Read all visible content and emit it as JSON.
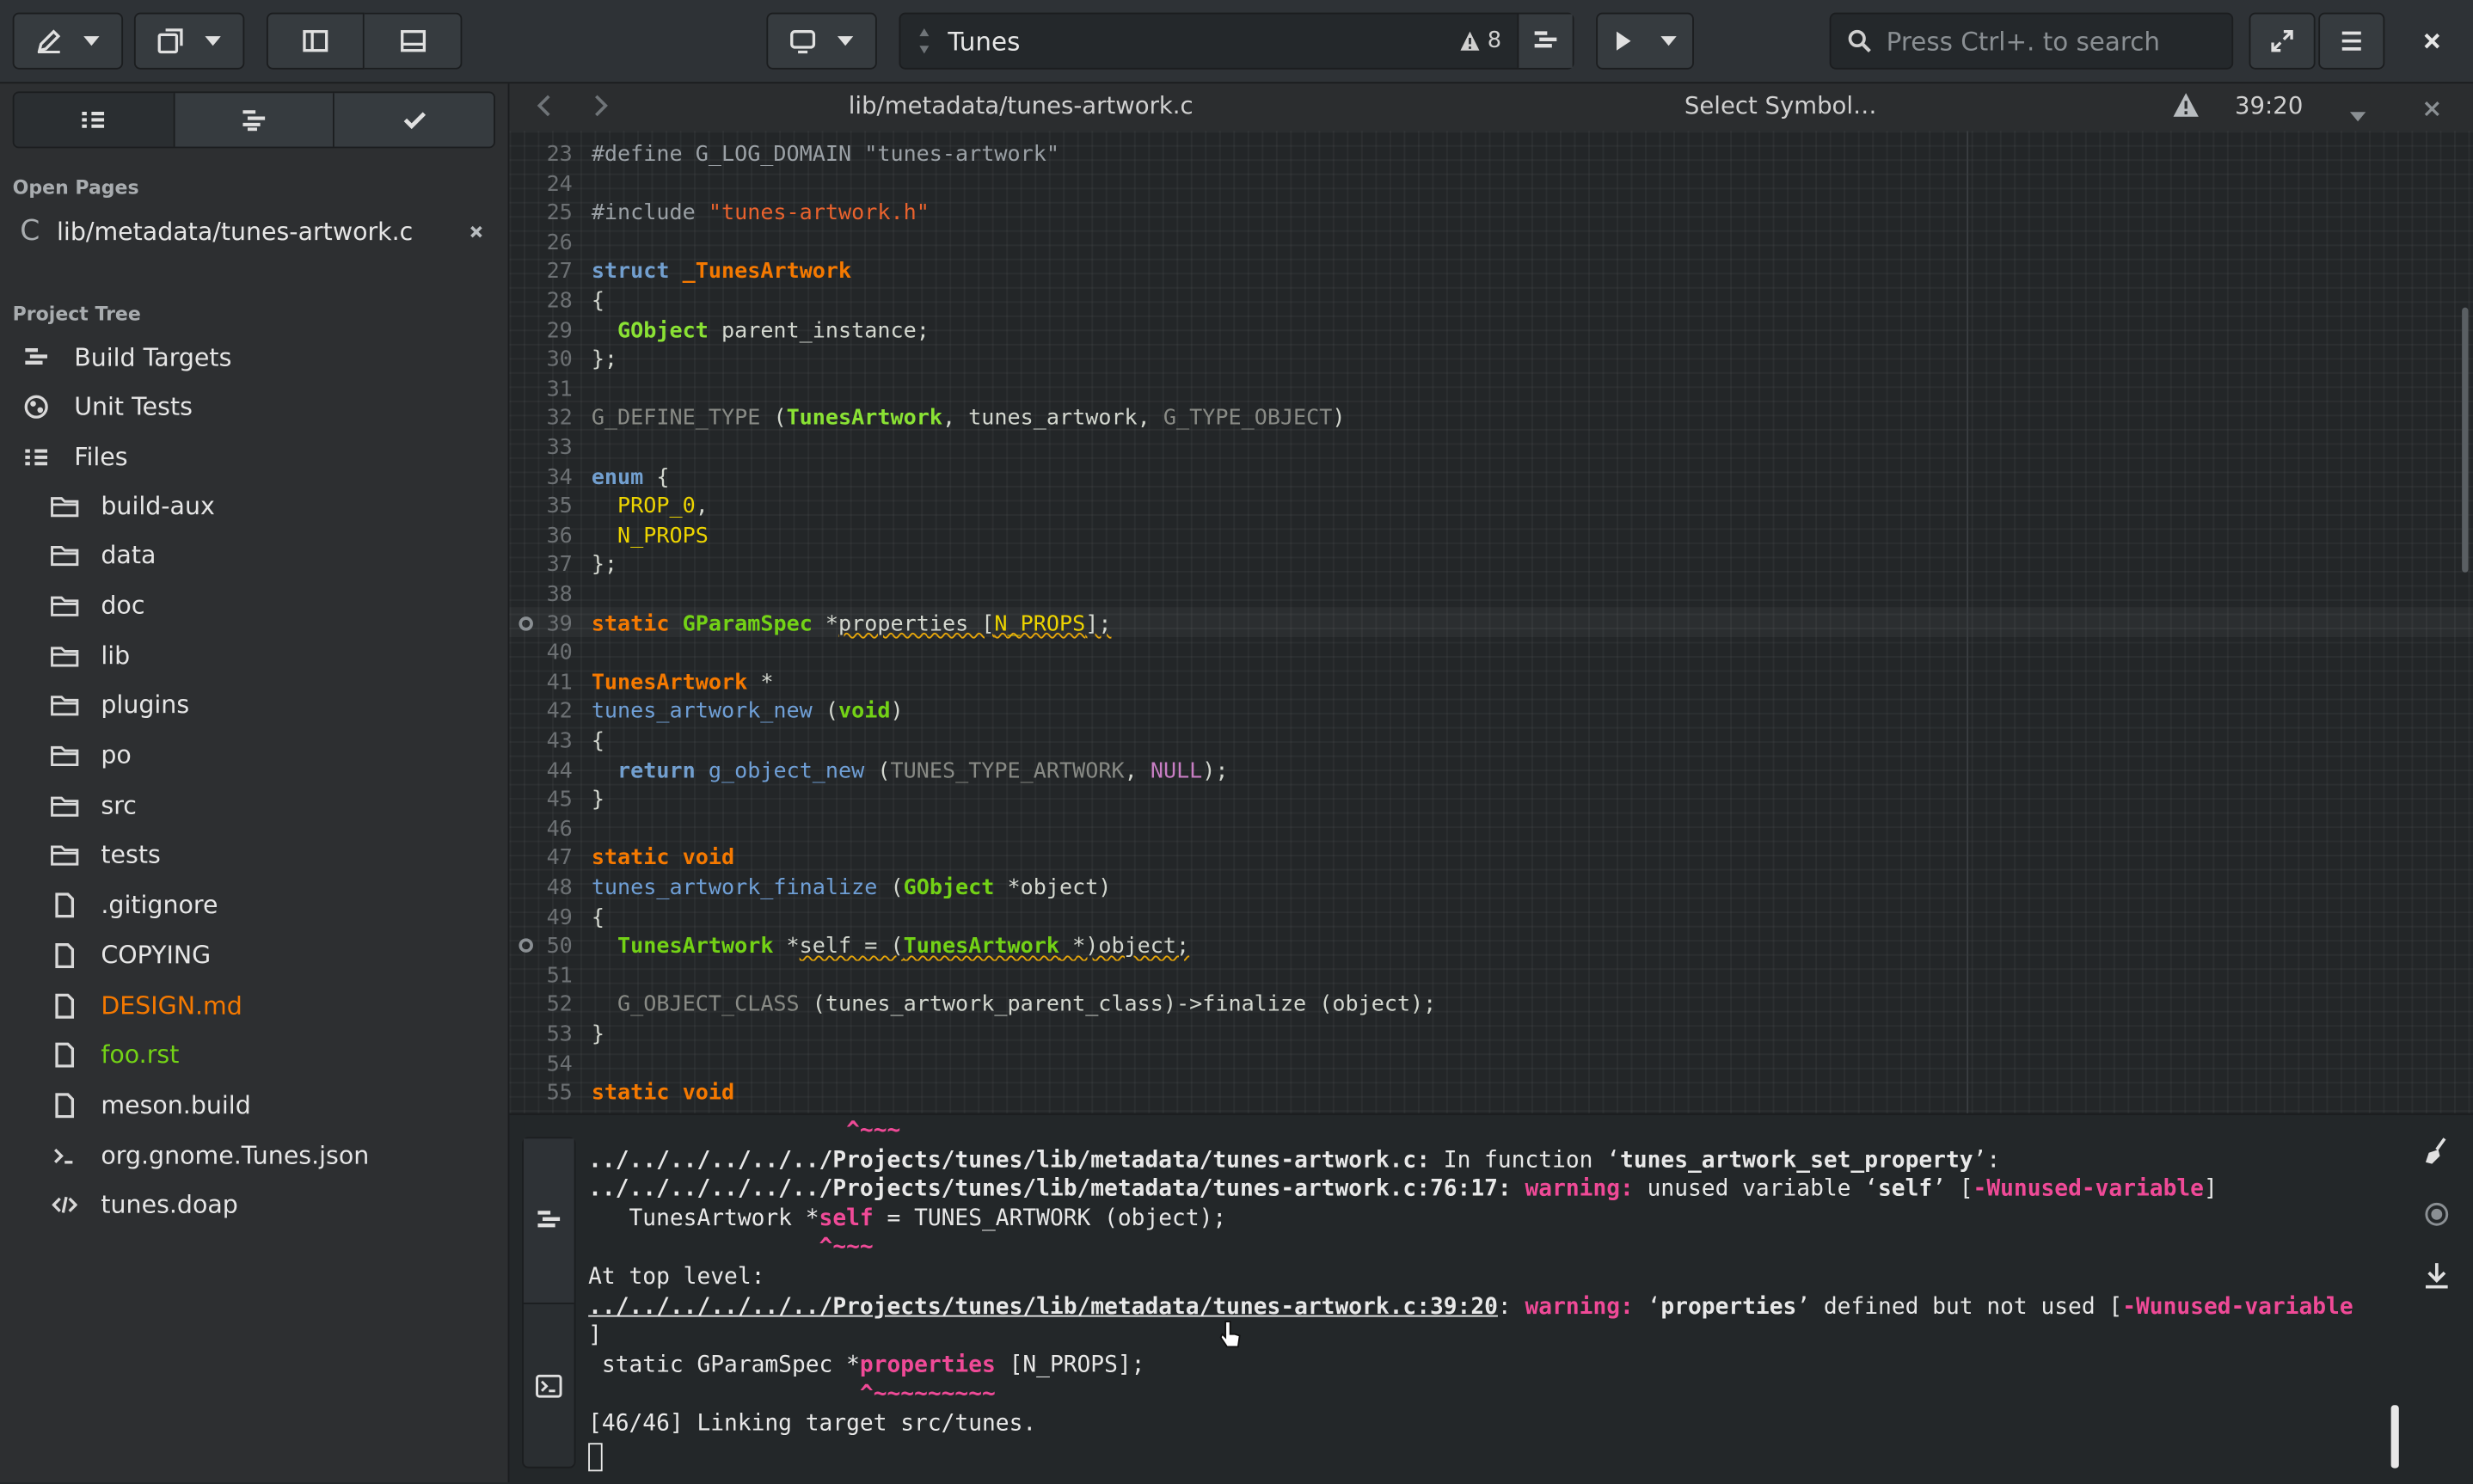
{
  "header": {
    "project_name": "Tunes",
    "warning_count": "8",
    "search_placeholder": "Press Ctrl+. to search"
  },
  "sidebar": {
    "open_pages_title": "Open Pages",
    "open_page": "lib/metadata/tunes-artwork.c",
    "open_page_icon_text": "C",
    "project_tree_title": "Project Tree",
    "top_items": [
      {
        "label": "Build Targets",
        "icon": "build-targets-icon"
      },
      {
        "label": "Unit Tests",
        "icon": "unit-tests-icon"
      },
      {
        "label": "Files",
        "icon": "files-icon"
      }
    ],
    "files": [
      {
        "label": "build-aux",
        "kind": "folder",
        "color": "#e6e6e6"
      },
      {
        "label": "data",
        "kind": "folder",
        "color": "#e6e6e6"
      },
      {
        "label": "doc",
        "kind": "folder",
        "color": "#e6e6e6"
      },
      {
        "label": "lib",
        "kind": "folder",
        "color": "#e6e6e6"
      },
      {
        "label": "plugins",
        "kind": "folder",
        "color": "#e6e6e6"
      },
      {
        "label": "po",
        "kind": "folder",
        "color": "#e6e6e6"
      },
      {
        "label": "src",
        "kind": "folder",
        "color": "#e6e6e6"
      },
      {
        "label": "tests",
        "kind": "folder",
        "color": "#e6e6e6"
      },
      {
        "label": ".gitignore",
        "kind": "file",
        "color": "#e6e6e6"
      },
      {
        "label": "COPYING",
        "kind": "file",
        "color": "#e6e6e6"
      },
      {
        "label": "DESIGN.md",
        "kind": "file",
        "color": "#f57900"
      },
      {
        "label": "foo.rst",
        "kind": "file",
        "color": "#73d216"
      },
      {
        "label": "meson.build",
        "kind": "file",
        "color": "#e6e6e6"
      },
      {
        "label": "org.gnome.Tunes.json",
        "kind": "terminal",
        "color": "#e6e6e6"
      },
      {
        "label": "tunes.doap",
        "kind": "code",
        "color": "#e6e6e6"
      }
    ]
  },
  "editor": {
    "file_path": "lib/metadata/tunes-artwork.c",
    "symbol_selector": "Select Symbol…",
    "cursor_position": "39:20",
    "lines": [
      {
        "n": "23",
        "html": "<span class=\"pp\">#define G_LOG_DOMAIN \"tunes-artwork\"</span>"
      },
      {
        "n": "24",
        "html": ""
      },
      {
        "n": "25",
        "html": "<span class=\"pp\">#include </span><span class=\"st\">\"tunes-artwork.h\"</span>"
      },
      {
        "n": "26",
        "html": ""
      },
      {
        "n": "27",
        "html": "<span class=\"kw\">struct</span> <span class=\"kw2\">_TunesArtwork</span>"
      },
      {
        "n": "28",
        "html": "{"
      },
      {
        "n": "29",
        "html": "  <span class=\"ty2\">GObject</span> parent_instance;"
      },
      {
        "n": "30",
        "html": "};"
      },
      {
        "n": "31",
        "html": ""
      },
      {
        "n": "32",
        "html": "<span class=\"mac\">G_DEFINE_TYPE</span> (<span class=\"ty2\">TunesArtwork</span>, tunes_artwork, <span class=\"mac\">G_TYPE_OBJECT</span>)"
      },
      {
        "n": "33",
        "html": ""
      },
      {
        "n": "34",
        "html": "<span class=\"kw\">enum</span> {"
      },
      {
        "n": "35",
        "html": "  <span class=\"cn\">PROP_0</span>,"
      },
      {
        "n": "36",
        "html": "  <span class=\"cn\">N_PROPS</span>"
      },
      {
        "n": "37",
        "html": "};"
      },
      {
        "n": "38",
        "html": ""
      },
      {
        "n": "39",
        "html": "<span class=\"kw2\">static</span> <span class=\"ty\">GParamSpec</span> *<span class=\"err\">properties [<span class=\"cn\">N_PROPS</span>];</span>",
        "mark": true
      },
      {
        "n": "40",
        "html": ""
      },
      {
        "n": "41",
        "html": "<span class=\"kw2\">TunesArtwork</span> *"
      },
      {
        "n": "42",
        "html": "<span class=\"fn\">tunes_artwork_new</span> (<span class=\"ty\">void</span>)"
      },
      {
        "n": "43",
        "html": "{"
      },
      {
        "n": "44",
        "html": "  <span class=\"kw\">return</span> <span class=\"fn\">g_object_new</span> (<span class=\"mac\">TUNES_TYPE_ARTWORK</span>, <span class=\"nul\">NULL</span>);"
      },
      {
        "n": "45",
        "html": "}"
      },
      {
        "n": "46",
        "html": ""
      },
      {
        "n": "47",
        "html": "<span class=\"kw2\">static</span> <span class=\"kw2\">void</span>"
      },
      {
        "n": "48",
        "html": "<span class=\"fn\">tunes_artwork_finalize</span> (<span class=\"ty\">GObject</span> *object)"
      },
      {
        "n": "49",
        "html": "{"
      },
      {
        "n": "50",
        "html": "  <span class=\"ty\">TunesArtwork</span> *<span class=\"err\">self = (<span class=\"ty\">TunesArtwork</span> *)object;</span>",
        "mark": true
      },
      {
        "n": "51",
        "html": ""
      },
      {
        "n": "52",
        "html": "  <span class=\"mac\">G_OBJECT_CLASS</span> (tunes_artwork_parent_class)-&gt;finalize (object);"
      },
      {
        "n": "53",
        "html": "}"
      },
      {
        "n": "54",
        "html": ""
      },
      {
        "n": "55",
        "html": "<span class=\"kw2\">static</span> <span class=\"kw2\">void</span>"
      }
    ]
  },
  "terminal": {
    "lines": [
      {
        "html": "                   <span class=\"tw\">^~~~</span>"
      },
      {
        "html": "<span class=\"tb\">../../../../../../Projects/tunes/lib/metadata/tunes-artwork.c:</span> In function ‘<span class=\"tb\">tunes_artwork_set_property</span>’:"
      },
      {
        "html": "<span class=\"tb\">../../../../../../Projects/tunes/lib/metadata/tunes-artwork.c:76:17:</span> <span class=\"tw\">warning:</span> unused variable ‘<span class=\"tb\">self</span>’ [<span class=\"tw\">-Wunused-variable</span>]"
      },
      {
        "html": "   TunesArtwork *<span class=\"tw\">self</span> = TUNES_ARTWORK (object);"
      },
      {
        "html": "                 <span class=\"tw\">^~~~</span>"
      },
      {
        "html": "At top level:"
      },
      {
        "html": "<span class=\"tb\" style=\"text-decoration:underline\">../../../../../../Projects/tunes/lib/metadata/tunes-artwork.c:39:20</span>: <span class=\"tw\">warning:</span> ‘<span class=\"tb\">properties</span>’ defined but not used [<span class=\"tw\">-Wunused-variable</span>"
      },
      {
        "html": "]"
      },
      {
        "html": " static GParamSpec *<span class=\"tw\">properties</span> [N_PROPS];"
      },
      {
        "html": "                    <span class=\"tw\">^~~~~~~~~~</span>"
      },
      {
        "html": "[46/46] Linking target src/tunes."
      }
    ]
  }
}
